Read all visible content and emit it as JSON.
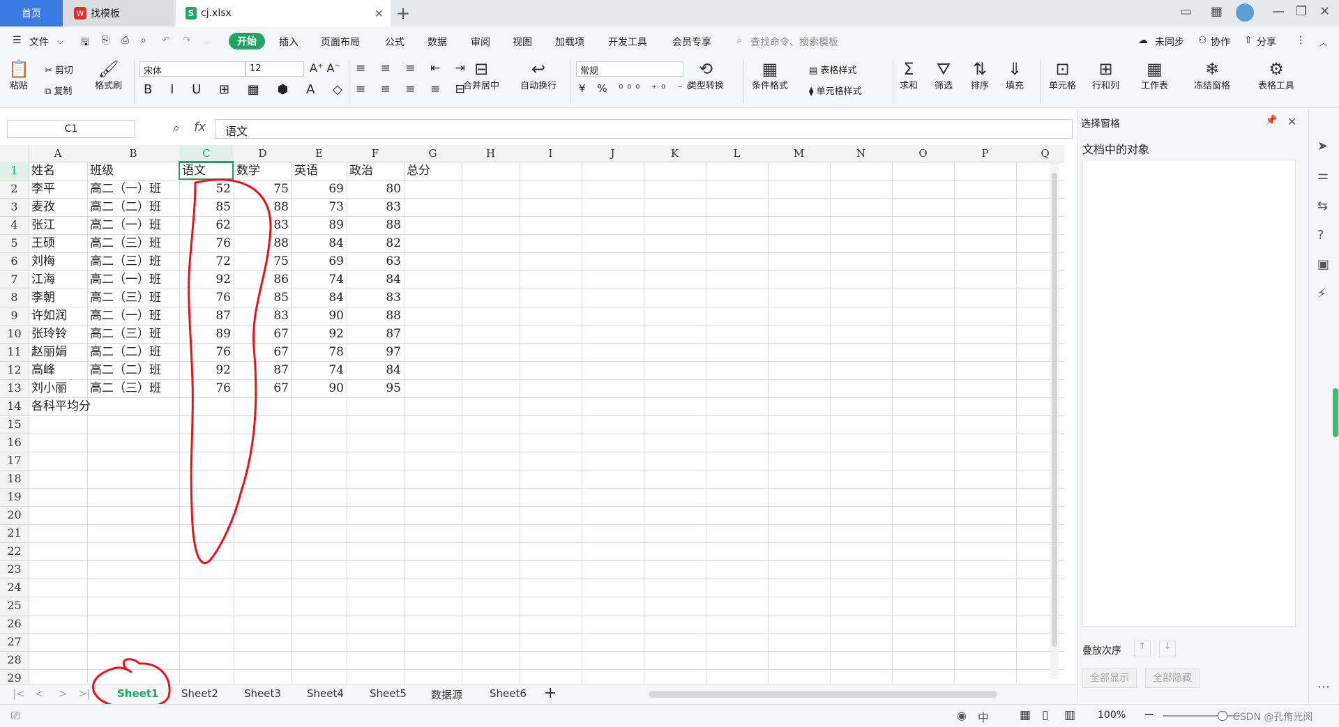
{
  "tabs": {
    "home": "首页",
    "template": "找模板",
    "document": "cj.xlsx"
  },
  "menu": [
    "文件",
    "开始",
    "插入",
    "页面布局",
    "公式",
    "数据",
    "审阅",
    "视图",
    "加载项",
    "开发工具",
    "会员专享"
  ],
  "menu_active": "开始",
  "search_placeholder": "查找命令、搜索模板",
  "top_right": {
    "sync": "未同步",
    "collab": "协作",
    "share": "分享"
  },
  "ribbon": {
    "paste": "粘贴",
    "cut": "剪切",
    "copy": "复制",
    "format_painter": "格式刷",
    "font": "宋体",
    "size": "12",
    "merge": "合并居中",
    "wrap": "自动换行",
    "number_format": "常规",
    "convert": "类型转换",
    "cond_format": "条件格式",
    "table_style": "表格样式",
    "cell_style": "单元格样式",
    "sum": "求和",
    "filter": "筛选",
    "sort": "排序",
    "fill": "填充",
    "cell": "单元格",
    "rowcol": "行和列",
    "sheet": "工作表",
    "freeze": "冻结窗格",
    "tools": "表格工具"
  },
  "formula_bar": {
    "name_box": "C1",
    "fx": "fx",
    "content": "语文"
  },
  "columns": [
    "A",
    "B",
    "C",
    "D",
    "E",
    "F",
    "G",
    "H",
    "I",
    "J",
    "K",
    "L",
    "M",
    "N",
    "O",
    "P",
    "Q"
  ],
  "rows": [
    [
      "姓名",
      "班级",
      "语文",
      "数学",
      "英语",
      "政治",
      "总分"
    ],
    [
      "李平",
      "高二（一）班",
      "52",
      "75",
      "69",
      "80",
      ""
    ],
    [
      "麦孜",
      "高二（二）班",
      "85",
      "88",
      "73",
      "83",
      ""
    ],
    [
      "张江",
      "高二（一）班",
      "62",
      "83",
      "89",
      "88",
      ""
    ],
    [
      "王硕",
      "高二（三）班",
      "76",
      "88",
      "84",
      "82",
      ""
    ],
    [
      "刘梅",
      "高二（三）班",
      "72",
      "75",
      "69",
      "63",
      ""
    ],
    [
      "江海",
      "高二（一）班",
      "92",
      "86",
      "74",
      "84",
      ""
    ],
    [
      "李朝",
      "高二（三）班",
      "76",
      "85",
      "84",
      "83",
      ""
    ],
    [
      "许如润",
      "高二（一）班",
      "87",
      "83",
      "90",
      "88",
      ""
    ],
    [
      "张玲铃",
      "高二（三）班",
      "89",
      "67",
      "92",
      "87",
      ""
    ],
    [
      "赵丽娟",
      "高二（二）班",
      "76",
      "67",
      "78",
      "97",
      ""
    ],
    [
      "高峰",
      "高二（二）班",
      "92",
      "87",
      "74",
      "84",
      ""
    ],
    [
      "刘小丽",
      "高二（三）班",
      "76",
      "67",
      "90",
      "95",
      ""
    ],
    [
      "各科平均分",
      "",
      "",
      "",
      "",
      "",
      ""
    ]
  ],
  "row_numbers": [
    "1",
    "2",
    "3",
    "4",
    "5",
    "6",
    "7",
    "8",
    "9",
    "10",
    "11",
    "12",
    "13",
    "14",
    "15",
    "16",
    "17",
    "18",
    "19",
    "20",
    "21",
    "22",
    "23",
    "24",
    "25",
    "26",
    "27",
    "28",
    "29"
  ],
  "sheets": [
    "Sheet1",
    "Sheet2",
    "Sheet3",
    "Sheet4",
    "Sheet5",
    "数据源",
    "Sheet6"
  ],
  "active_sheet": "Sheet1",
  "pane": {
    "title": "选择窗格",
    "subtitle": "文档中的对象",
    "order_label": "叠放次序",
    "show_all": "全部显示",
    "hide_all": "全部隐藏"
  },
  "status": {
    "zoom": "100%",
    "watermark": "CSDN @孔侑光阅"
  },
  "colors": {
    "accent": "#1fa463",
    "home_tab": "#3a7be4",
    "annotation": "#e8111b"
  }
}
